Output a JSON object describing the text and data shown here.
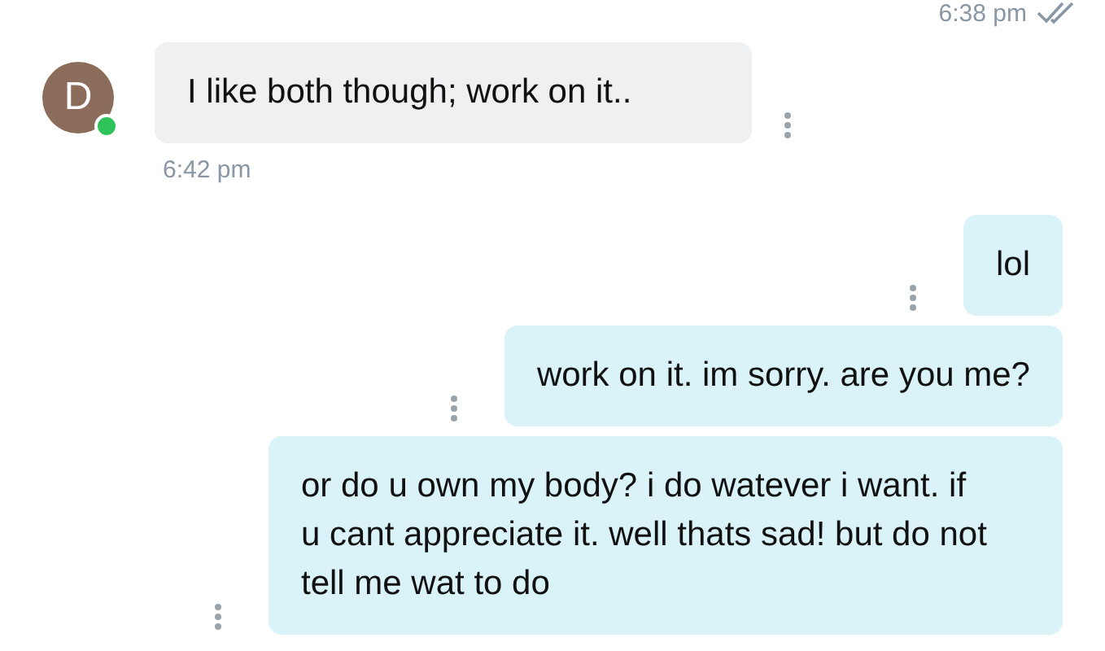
{
  "header": {
    "time": "6:38 pm",
    "read": true
  },
  "messages": [
    {
      "kind": "incoming",
      "sender_initial": "D",
      "online": true,
      "text": "I like both though; work on it..",
      "time": "6:42 pm"
    },
    {
      "kind": "outgoing",
      "text": "lol"
    },
    {
      "kind": "outgoing",
      "text": "work on it. im sorry. are you me?"
    },
    {
      "kind": "outgoing",
      "text": "or do u own my body? i do watever i want. if u cant appreciate it. well thats sad! but do not tell me wat to do"
    }
  ]
}
